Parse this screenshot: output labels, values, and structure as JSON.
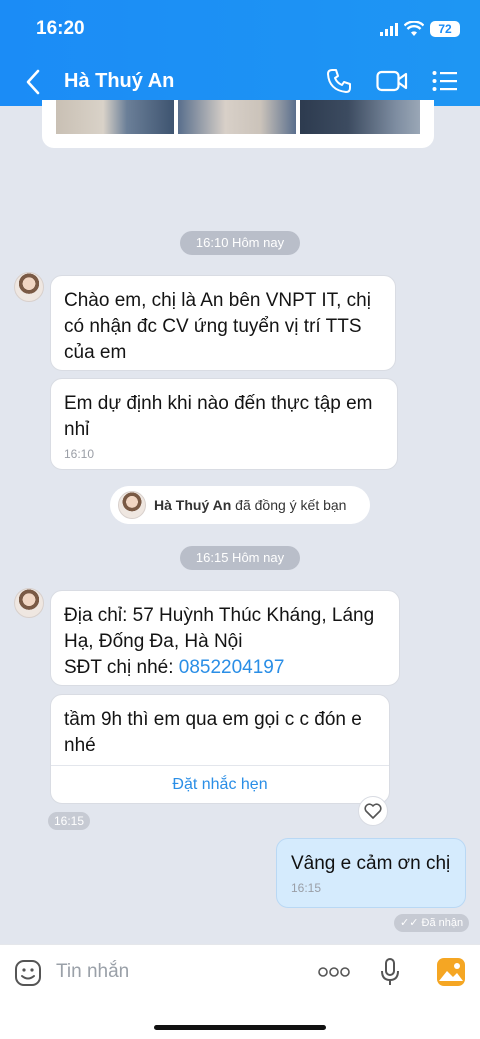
{
  "status": {
    "time": "16:20",
    "battery": "72"
  },
  "header": {
    "title": "Hà Thuý An",
    "icons": [
      "back-icon",
      "phone-icon",
      "video-call-icon",
      "menu-icon"
    ]
  },
  "messages": {
    "pill1": "16:10 Hôm nay",
    "m1": "Chào em, chị là An bên VNPT IT, chị có nhận đc CV ứng tuyển vị trí TTS của em",
    "m2": "Em dự định khi nào đến thực tập em nhỉ",
    "m2_time": "16:10",
    "friend_name": "Hà Thuý An",
    "friend_text": "đã đồng ý kết bạn",
    "pill2": "16:15 Hôm nay",
    "m3_line1": "Địa chỉ: 57 Huỳnh Thúc Kháng, Láng Hạ, Đống Đa, Hà Nội",
    "m3_phone_label": "SĐT chị nhé:",
    "m3_phone": "0852204197",
    "m4": "tầm 9h thì em qua em gọi c c đón e nhé",
    "m4_action": "Đặt nhắc hẹn",
    "m4_time": "16:15",
    "me": "Vâng e cảm ơn chị",
    "me_time": "16:15",
    "me_status": "Đã nhận"
  },
  "composer": {
    "placeholder": "Tin nhắn"
  }
}
